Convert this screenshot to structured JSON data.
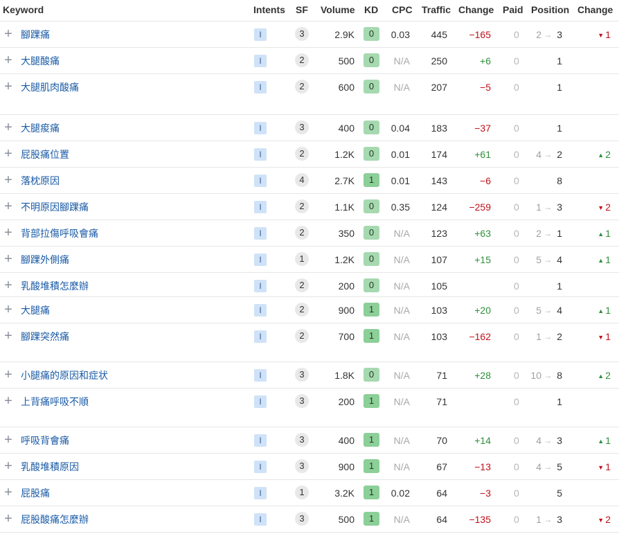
{
  "headers": {
    "keyword": "Keyword",
    "intents": "Intents",
    "sf": "SF",
    "volume": "Volume",
    "kd": "KD",
    "cpc": "CPC",
    "traffic": "Traffic",
    "change": "Change",
    "paid": "Paid",
    "position": "Position",
    "position_change": "Change"
  },
  "arrow_glyph": "→",
  "expand_glyph": "+",
  "rows": [
    {
      "keyword": "腳踝痛",
      "intent": "I",
      "sf": "3",
      "volume": "2.9K",
      "kd": "0",
      "cpc": "0.03",
      "traffic": "445",
      "change": "−165",
      "change_dir": "neg",
      "paid": "0",
      "pos_prev": "2",
      "pos_cur": "3",
      "pos_change": "1",
      "pos_change_dir": "down",
      "height": "normal"
    },
    {
      "keyword": "大腿酸痛",
      "intent": "I",
      "sf": "2",
      "volume": "500",
      "kd": "0",
      "cpc": "N/A",
      "traffic": "250",
      "change": "+6",
      "change_dir": "pos",
      "paid": "0",
      "pos_prev": "",
      "pos_cur": "1",
      "pos_change": "",
      "pos_change_dir": "",
      "height": "normal"
    },
    {
      "keyword": "大腿肌肉酸痛",
      "intent": "I",
      "sf": "2",
      "volume": "600",
      "kd": "0",
      "cpc": "N/A",
      "traffic": "207",
      "change": "−5",
      "change_dir": "neg",
      "paid": "0",
      "pos_prev": "",
      "pos_cur": "1",
      "pos_change": "",
      "pos_change_dir": "",
      "height": "tall"
    },
    {
      "keyword": "大腿痠痛",
      "intent": "I",
      "sf": "3",
      "volume": "400",
      "kd": "0",
      "cpc": "0.04",
      "traffic": "183",
      "change": "−37",
      "change_dir": "neg",
      "paid": "0",
      "pos_prev": "",
      "pos_cur": "1",
      "pos_change": "",
      "pos_change_dir": "",
      "height": "normal"
    },
    {
      "keyword": "屁股痛位置",
      "intent": "I",
      "sf": "2",
      "volume": "1.2K",
      "kd": "0",
      "cpc": "0.01",
      "traffic": "174",
      "change": "+61",
      "change_dir": "pos",
      "paid": "0",
      "pos_prev": "4",
      "pos_cur": "2",
      "pos_change": "2",
      "pos_change_dir": "up",
      "height": "normal"
    },
    {
      "keyword": "落枕原因",
      "intent": "I",
      "sf": "4",
      "volume": "2.7K",
      "kd": "1",
      "cpc": "0.01",
      "traffic": "143",
      "change": "−6",
      "change_dir": "neg",
      "paid": "0",
      "pos_prev": "",
      "pos_cur": "8",
      "pos_change": "",
      "pos_change_dir": "",
      "height": "normal"
    },
    {
      "keyword": "不明原因腳踝痛",
      "intent": "I",
      "sf": "2",
      "volume": "1.1K",
      "kd": "0",
      "cpc": "0.35",
      "traffic": "124",
      "change": "−259",
      "change_dir": "neg",
      "paid": "0",
      "pos_prev": "1",
      "pos_cur": "3",
      "pos_change": "2",
      "pos_change_dir": "down",
      "height": "normal"
    },
    {
      "keyword": "背部拉傷呼吸會痛",
      "intent": "I",
      "sf": "2",
      "volume": "350",
      "kd": "0",
      "cpc": "N/A",
      "traffic": "123",
      "change": "+63",
      "change_dir": "pos",
      "paid": "0",
      "pos_prev": "2",
      "pos_cur": "1",
      "pos_change": "1",
      "pos_change_dir": "up",
      "height": "normal"
    },
    {
      "keyword": "腳踝外側痛",
      "intent": "I",
      "sf": "1",
      "volume": "1.2K",
      "kd": "0",
      "cpc": "N/A",
      "traffic": "107",
      "change": "+15",
      "change_dir": "pos",
      "paid": "0",
      "pos_prev": "5",
      "pos_cur": "4",
      "pos_change": "1",
      "pos_change_dir": "up",
      "height": "normal"
    },
    {
      "keyword": "乳酸堆積怎麼辦",
      "intent": "I",
      "sf": "2",
      "volume": "200",
      "kd": "0",
      "cpc": "N/A",
      "traffic": "105",
      "change": "",
      "change_dir": "",
      "paid": "0",
      "pos_prev": "",
      "pos_cur": "1",
      "pos_change": "",
      "pos_change_dir": "",
      "height": "short"
    },
    {
      "keyword": "大腿痛",
      "intent": "I",
      "sf": "2",
      "volume": "900",
      "kd": "1",
      "cpc": "N/A",
      "traffic": "103",
      "change": "+20",
      "change_dir": "pos",
      "paid": "0",
      "pos_prev": "5",
      "pos_cur": "4",
      "pos_change": "1",
      "pos_change_dir": "up",
      "height": "normal"
    },
    {
      "keyword": "腳踝突然痛",
      "intent": "I",
      "sf": "2",
      "volume": "700",
      "kd": "1",
      "cpc": "N/A",
      "traffic": "103",
      "change": "−162",
      "change_dir": "neg",
      "paid": "0",
      "pos_prev": "1",
      "pos_cur": "2",
      "pos_change": "1",
      "pos_change_dir": "down",
      "height": "mid"
    },
    {
      "keyword": "小腿痛的原因和症状",
      "intent": "I",
      "sf": "3",
      "volume": "1.8K",
      "kd": "0",
      "cpc": "N/A",
      "traffic": "71",
      "change": "+28",
      "change_dir": "pos",
      "paid": "0",
      "pos_prev": "10",
      "pos_cur": "8",
      "pos_change": "2",
      "pos_change_dir": "up",
      "height": "normal"
    },
    {
      "keyword": "上背痛呼吸不順",
      "intent": "I",
      "sf": "3",
      "volume": "200",
      "kd": "1",
      "cpc": "N/A",
      "traffic": "71",
      "change": "",
      "change_dir": "",
      "paid": "0",
      "pos_prev": "",
      "pos_cur": "1",
      "pos_change": "",
      "pos_change_dir": "",
      "height": "mid"
    },
    {
      "keyword": "呼吸背會痛",
      "intent": "I",
      "sf": "3",
      "volume": "400",
      "kd": "1",
      "cpc": "N/A",
      "traffic": "70",
      "change": "+14",
      "change_dir": "pos",
      "paid": "0",
      "pos_prev": "4",
      "pos_cur": "3",
      "pos_change": "1",
      "pos_change_dir": "up",
      "height": "normal"
    },
    {
      "keyword": "乳酸堆積原因",
      "intent": "I",
      "sf": "3",
      "volume": "900",
      "kd": "1",
      "cpc": "N/A",
      "traffic": "67",
      "change": "−13",
      "change_dir": "neg",
      "paid": "0",
      "pos_prev": "4",
      "pos_cur": "5",
      "pos_change": "1",
      "pos_change_dir": "down",
      "height": "normal"
    },
    {
      "keyword": "屁股痛",
      "intent": "I",
      "sf": "1",
      "volume": "3.2K",
      "kd": "1",
      "cpc": "0.02",
      "traffic": "64",
      "change": "−3",
      "change_dir": "neg",
      "paid": "0",
      "pos_prev": "",
      "pos_cur": "5",
      "pos_change": "",
      "pos_change_dir": "",
      "height": "normal"
    },
    {
      "keyword": "屁股酸痛怎麼辦",
      "intent": "I",
      "sf": "3",
      "volume": "500",
      "kd": "1",
      "cpc": "N/A",
      "traffic": "64",
      "change": "−135",
      "change_dir": "neg",
      "paid": "0",
      "pos_prev": "1",
      "pos_cur": "3",
      "pos_change": "2",
      "pos_change_dir": "down",
      "height": "normal"
    }
  ]
}
